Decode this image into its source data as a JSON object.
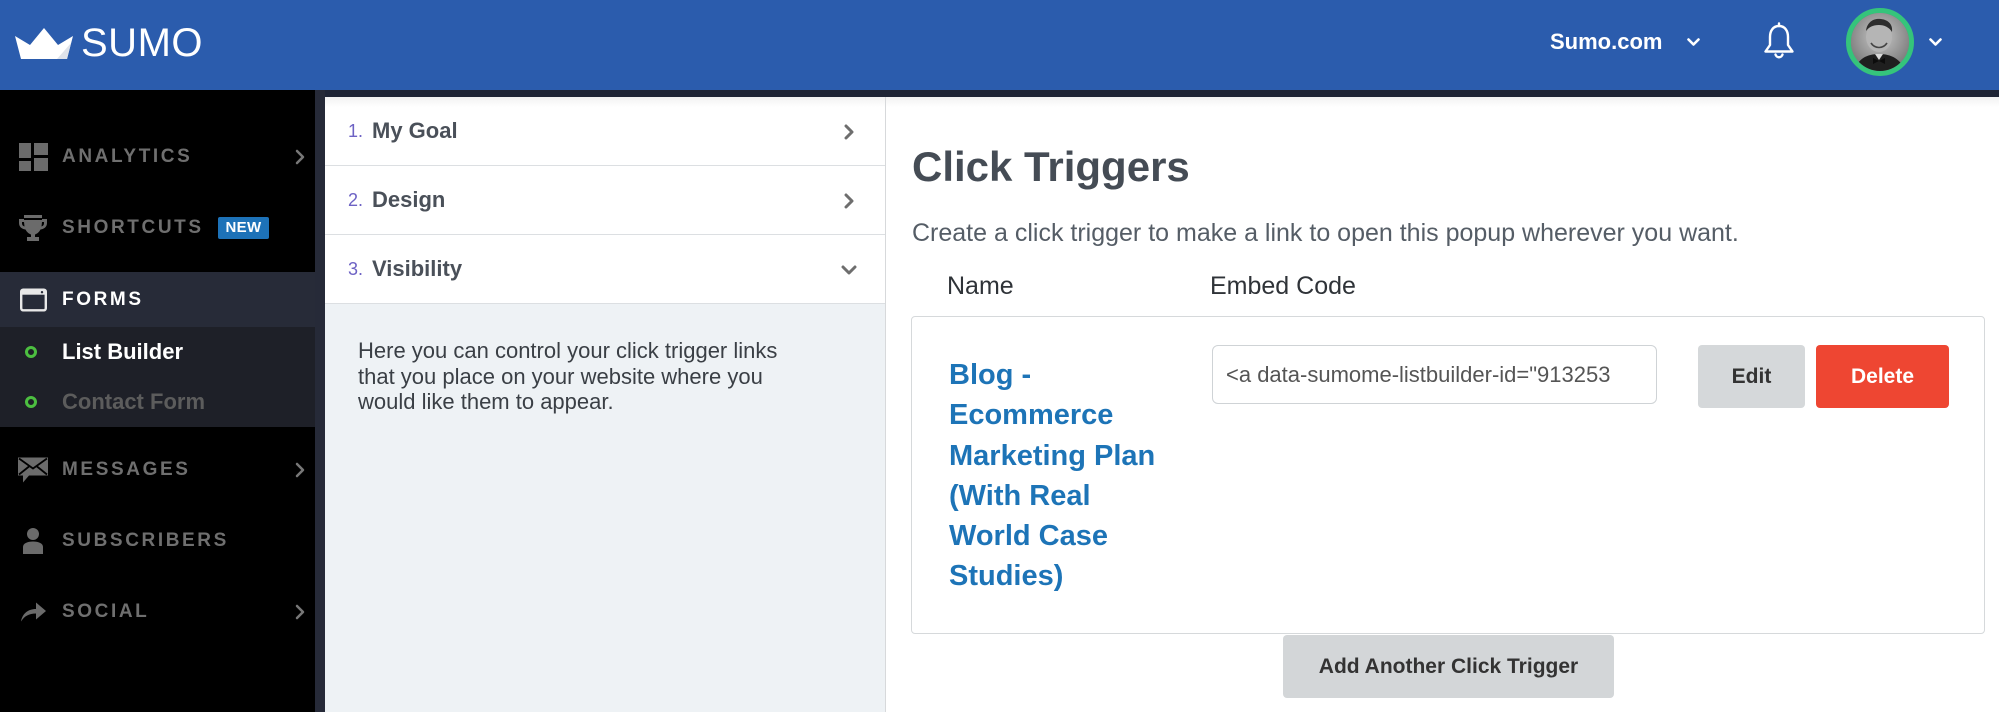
{
  "header": {
    "logo_text": "SUMO",
    "site_name": "Sumo.com",
    "icons": {
      "logo": "crown-icon",
      "site_dropdown": "chevron-down-icon",
      "notifications": "bell-icon",
      "account_dropdown": "chevron-down-icon"
    }
  },
  "sidebar": {
    "items": [
      {
        "label": "ANALYTICS",
        "icon": "dashboard-icon",
        "has_submenu": true
      },
      {
        "label": "SHORTCUTS",
        "icon": "trophy-icon",
        "badge": "NEW"
      },
      {
        "label": "FORMS",
        "icon": "window-icon",
        "active": true,
        "children": [
          {
            "label": "List Builder",
            "active": true
          },
          {
            "label": "Contact Form",
            "active": false
          }
        ]
      },
      {
        "label": "MESSAGES",
        "icon": "envelope-icon",
        "has_submenu": true
      },
      {
        "label": "SUBSCRIBERS",
        "icon": "user-icon"
      },
      {
        "label": "SOCIAL",
        "icon": "share-icon",
        "has_submenu": true
      }
    ]
  },
  "steps_panel": {
    "steps": [
      {
        "number": "1.",
        "label": "My Goal",
        "state": "collapsed"
      },
      {
        "number": "2.",
        "label": "Design",
        "state": "collapsed"
      },
      {
        "number": "3.",
        "label": "Visibility",
        "state": "expanded"
      }
    ],
    "help_text": "Here you can control your click trigger links that you place on your website where you would like them to appear."
  },
  "main": {
    "title": "Click Triggers",
    "subtitle": "Create a click trigger to make a link to open this popup wherever you want.",
    "columns": [
      "Name",
      "Embed Code"
    ],
    "triggers": [
      {
        "name": "Blog - Ecommerce Marketing Plan (With Real World Case Studies)",
        "embed_code": "<a data-sumome-listbuilder-id=\"913253",
        "edit_label": "Edit",
        "delete_label": "Delete"
      }
    ],
    "add_button_label": "Add Another Click Trigger"
  },
  "colors": {
    "header_bg": "#2b5cad",
    "sidebar_bg": "#000000",
    "sidebar_active_bg": "#272b38",
    "new_badge": "#1d72b8",
    "status_dot": "#4cbf40",
    "avatar_ring": "#35c47b",
    "step_number": "#6d62c4",
    "link": "#1d74b7",
    "delete": "#ee4632",
    "neutral_button": "#d5d8da"
  }
}
